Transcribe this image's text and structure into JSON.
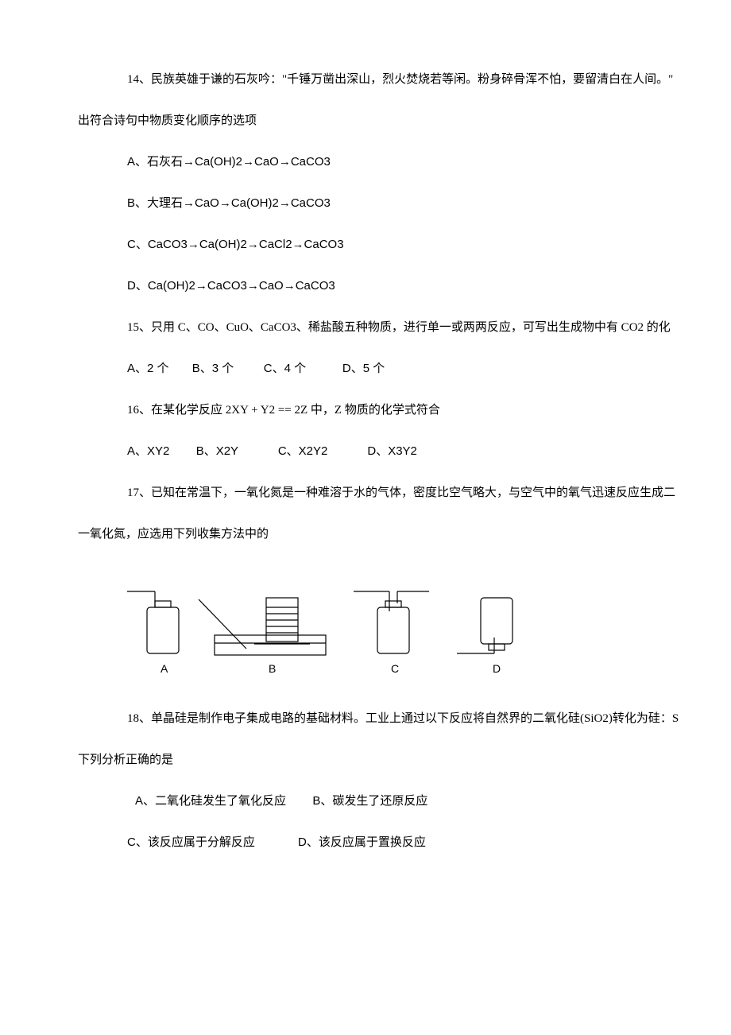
{
  "q14": {
    "stem_a": "14、民族英雄于谦的石灰吟：\"千锤万凿出深山，烈火焚烧若等闲。粉身碎骨浑不怕，要留清白在人间。\"",
    "stem_b": "出符合诗句中物质变化顺序的选项",
    "optA": "A、石灰石→Ca(OH)2→CaO→CaCO3",
    "optB": "B、大理石→CaO→Ca(OH)2→CaCO3",
    "optC": "C、CaCO3→Ca(OH)2→CaCl2→CaCO3",
    "optD": "D、Ca(OH)2→CaCO3→CaO→CaCO3"
  },
  "q15": {
    "stem": "15、只用 C、CO、CuO、CaCO3、稀盐酸五种物质，进行单一或两两反应，可写出生成物中有 CO2 的化",
    "optA": "A、2 个",
    "optB": "B、3 个",
    "optC": "C、4 个",
    "optD": "D、5 个"
  },
  "q16": {
    "stem": "16、在某化学反应 2XY + Y2 == 2Z 中，Z 物质的化学式符合",
    "optA": "A、XY2",
    "optB": "B、X2Y",
    "optC": "C、X2Y2",
    "optD": "D、X3Y2"
  },
  "q17": {
    "stem_a": "17、已知在常温下，一氧化氮是一种难溶于水的气体，密度比空气略大，与空气中的氧气迅速反应生成二",
    "stem_b": "一氧化氮，应选用下列收集方法中的",
    "labelA": "A",
    "labelB": "B",
    "labelC": "C",
    "labelD": "D"
  },
  "q18": {
    "stem_a": "18、单晶硅是制作电子集成电路的基础材料。工业上通过以下反应将自然界的二氧化硅(SiO2)转化为硅：S",
    "stem_b": "下列分析正确的是",
    "optA": "A、二氧化硅发生了氧化反应",
    "optB": "B、碳发生了还原反应",
    "optC": "C、该反应属于分解反应",
    "optD": "D、该反应属于置换反应"
  }
}
